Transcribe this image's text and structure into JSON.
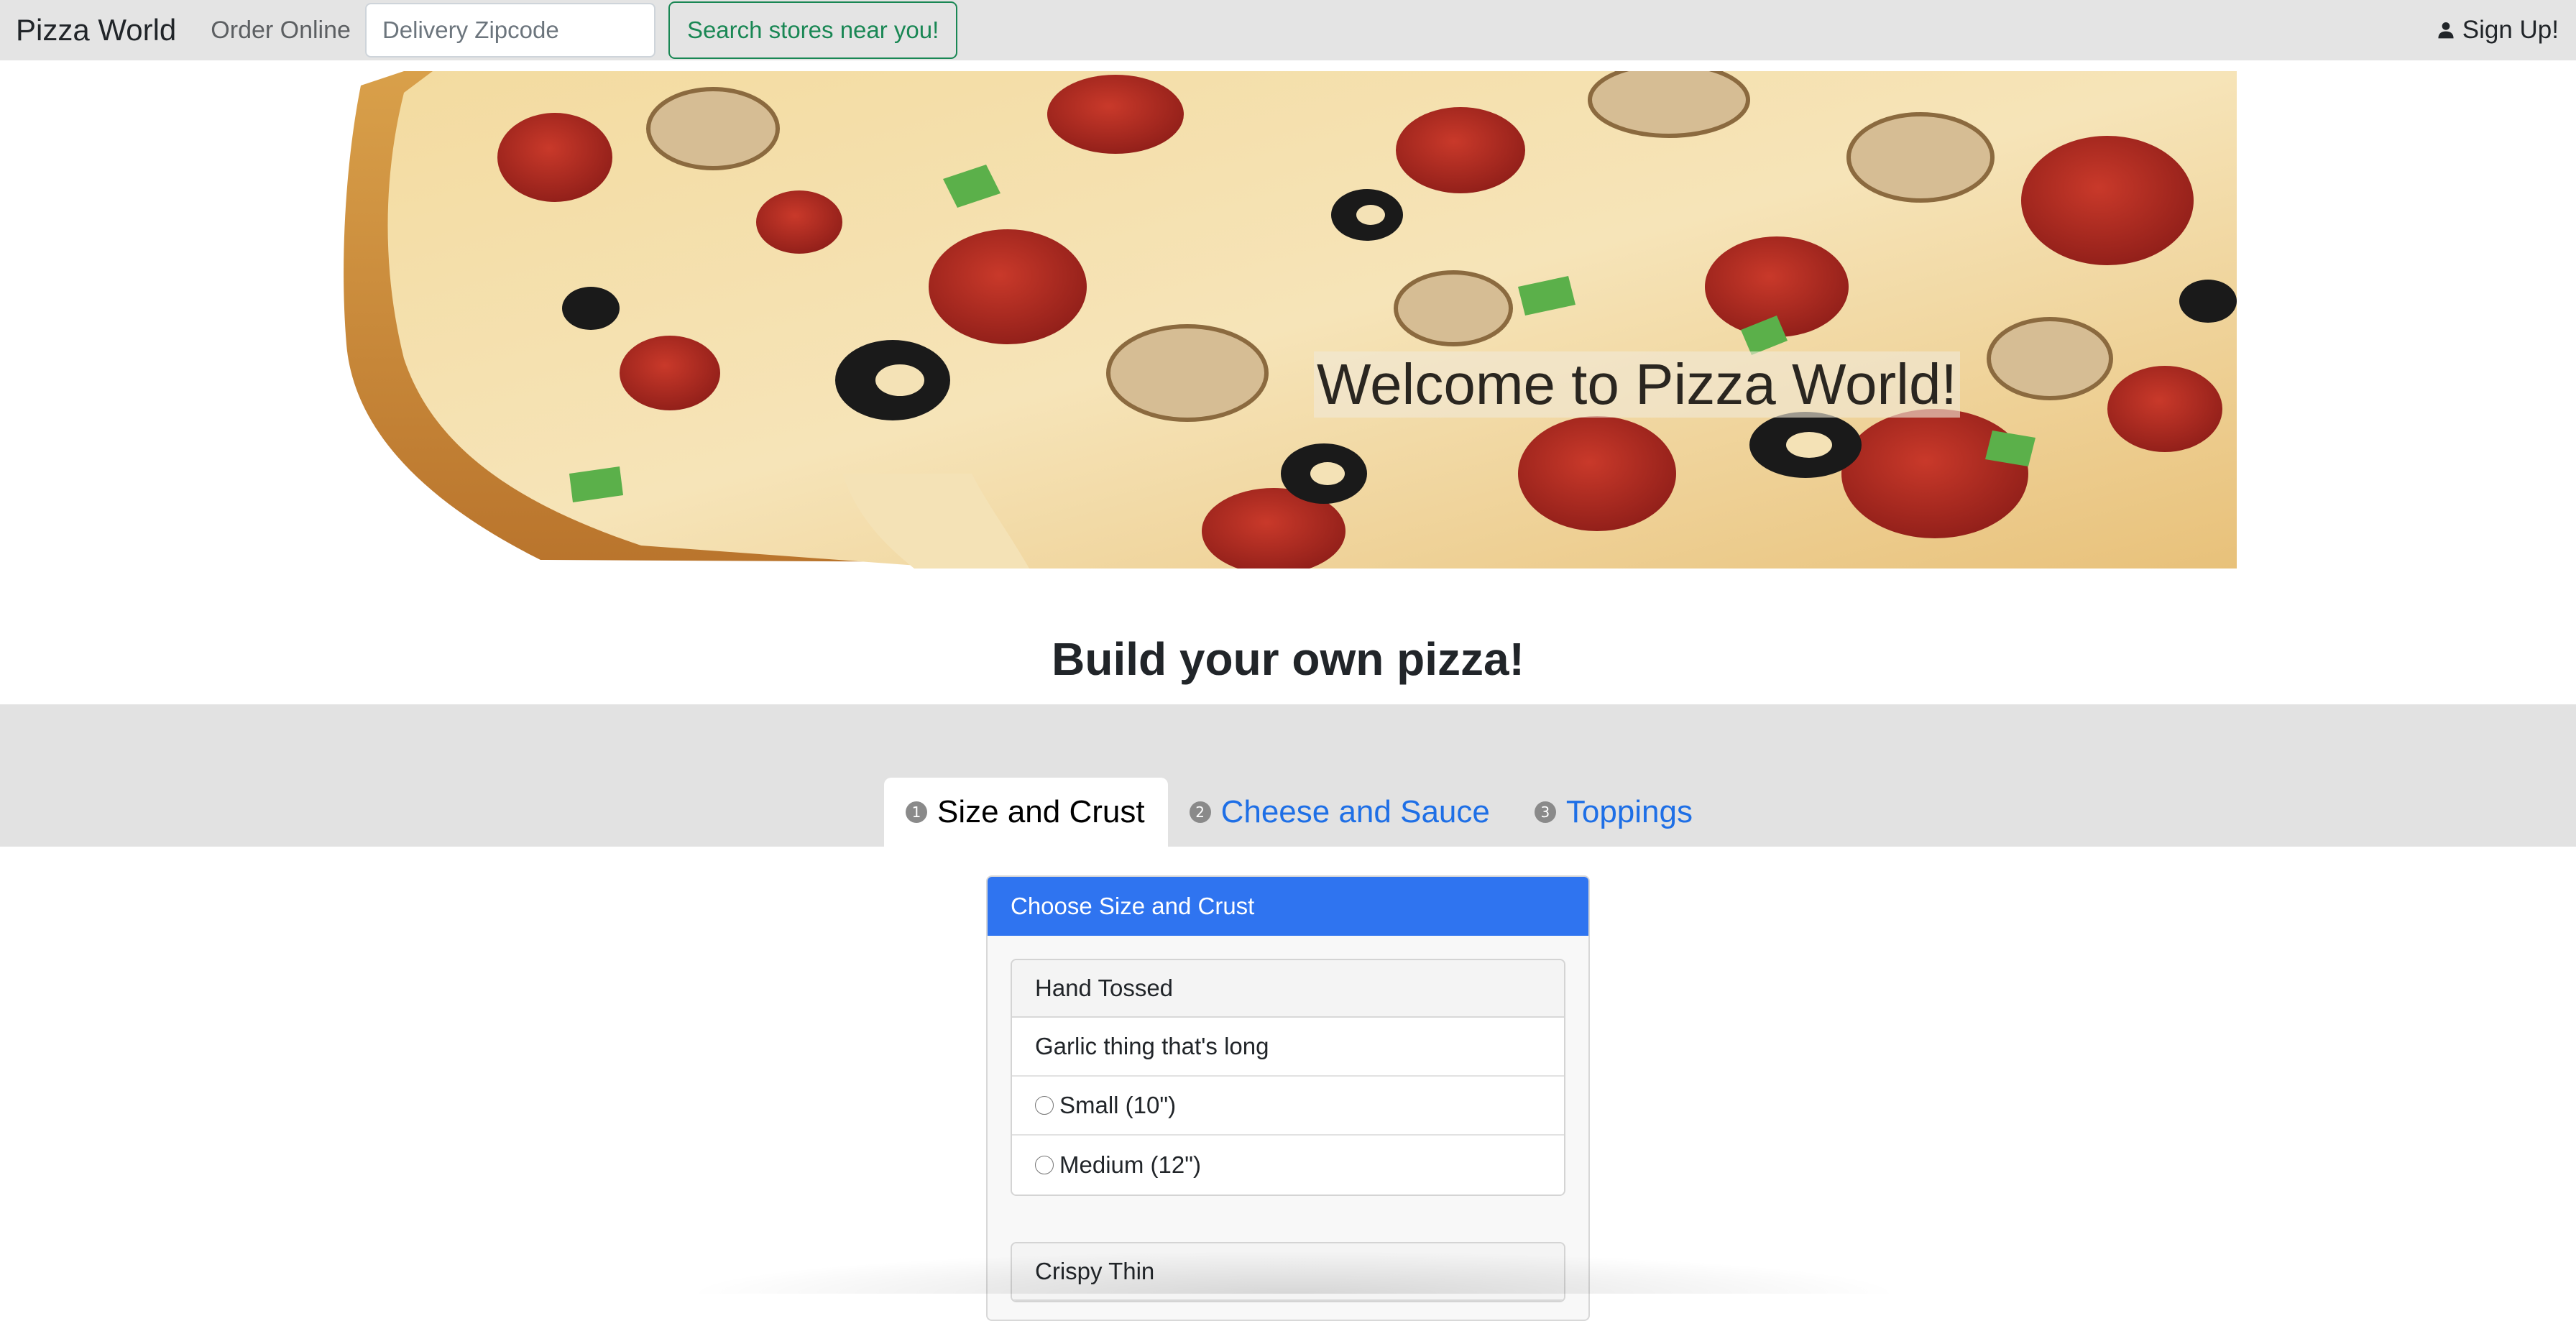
{
  "navbar": {
    "brand": "Pizza World",
    "order_online": "Order Online",
    "zip_placeholder": "Delivery Zipcode",
    "search_button": "Search stores near you!",
    "signup": "Sign Up!",
    "signup_icon": "person-icon"
  },
  "hero": {
    "title": "Welcome to Pizza World!"
  },
  "builder": {
    "title": "Build your own pizza!",
    "tabs": [
      {
        "step": "1",
        "label": "Size and Crust",
        "active": true
      },
      {
        "step": "2",
        "label": "Cheese and Sauce",
        "active": false
      },
      {
        "step": "3",
        "label": "Toppings",
        "active": false
      }
    ],
    "card": {
      "header": "Choose Size and Crust",
      "groups": [
        {
          "name": "Hand Tossed",
          "rows": [
            "Garlic thing that's long"
          ],
          "options": [
            "Small (10\")",
            "Medium (12\")"
          ]
        },
        {
          "name": "Crispy Thin"
        }
      ]
    }
  },
  "colors": {
    "navbar_bg": "#e4e4e4",
    "accent_blue": "#2f74f0",
    "link_blue": "#1e6fe6",
    "success_green": "#198754",
    "band_grey": "#e2e2e2"
  }
}
